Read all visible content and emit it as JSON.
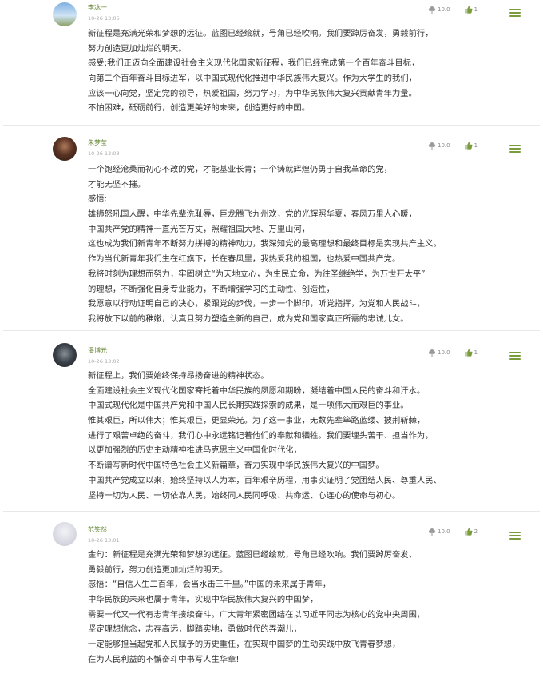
{
  "comments": [
    {
      "author": "李冰一",
      "time": "10-26 13:06",
      "score": "10.0",
      "likes": "1",
      "lines": [
        "新征程是充满光荣和梦想的远征。蓝图已经绘就，号角已经吹响。我们要踔厉奋发，勇毅前行，",
        "努力创造更加灿烂的明天。",
        "感受:我们正迈向全面建设社会主义现代化国家新征程，我们已经完成第一个百年奋斗目标，",
        "向第二个百年奋斗目标进军，以中国式现代化推进中华民族伟大复兴。作为大学生的我们，",
        "应该一心向党，坚定党的领导，热爱祖国，努力学习，为中华民族伟大复兴贡献青年力量。",
        "不怕困难，砥砺前行，创造更美好的未来，创造更好的中国。"
      ]
    },
    {
      "author": "朱梦莹",
      "time": "10-26 13:03",
      "score": "10.0",
      "likes": "1",
      "lines": [
        "一个饱经沧桑而初心不改的党，才能基业长青；一个铸就辉煌仍勇于自我革命的党，",
        "才能无坚不摧。",
        "感悟:",
        "雄狮怒吼国人醒，中华先辈洗耻辱，巨龙腾飞九州欢，党的光辉照华夏，春风万里人心暖，",
        "中国共产党的精神一直光芒万丈，照耀祖国大地、万里山河，",
        "这也成为我们新青年不断努力拼搏的精神动力，我深知党的最高理想和最终目标是实现共产主义。",
        "作为当代新青年我们生在红旗下，长在春风里，我热爱我的祖国，也热爱中国共产党。",
        "我将时刻为理想而努力，牢固树立“为天地立心，为生民立命，为往圣继绝学，为万世开太平”",
        "的理想，不断强化自身专业能力，不断增强学习的主动性、创造性，",
        "我愿意以行动证明自己的决心，紧跟党的步伐，一步一个脚印，听党指挥，为党和人民战斗，",
        "我将放下以前的稚嫩，认真且努力塑造全新的自己，成为党和国家真正所需的忠诚儿女。"
      ]
    },
    {
      "author": "潘博元",
      "time": "10-26 13:02",
      "score": "10.0",
      "likes": "1",
      "lines": [
        "新征程上，我们要始终保持昂扬奋进的精神状态。",
        "全面建设社会主义现代化国家寄托着中华民族的夙愿和期盼，凝结着中国人民的奋斗和汗水。",
        "中国式现代化是中国共产党和中国人民长期实践探索的成果，是一项伟大而艰巨的事业。",
        "惟其艰巨，所以伟大；惟其艰巨，更显荣光。为了这一事业，无数先辈筚路蓝缕、披荆斩棘，",
        "进行了艰苦卓绝的奋斗，我们心中永远铭记着他们的奉献和牺牲。我们要埋头苦干、担当作为，",
        "以更加强烈的历史主动精神推进马克思主义中国化时代化，",
        "不断谱写新时代中国特色社会主义新篇章，奋力实现中华民族伟大复兴的中国梦。",
        "中国共产党成立以来，始终坚持以人为本，百年艰辛历程，用事实证明了党团结人民、尊重人民、",
        "坚持一切为人民、一切依靠人民，始终同人民同呼吸、共命运、心连心的使命与初心。"
      ]
    },
    {
      "author": "范笑然",
      "time": "10-26 13:01",
      "score": "10.0",
      "likes": "2",
      "lines": [
        "金句：新征程是充满光荣和梦想的远征。蓝图已经绘就，号角已经吹响。我们要踔厉奋发、",
        "勇毅前行，努力创造更加灿烂的明天。",
        "感悟：“自信人生二百年，会当水击三千里。”中国的未来属于青年，",
        "中华民族的未来也属于青年。实现中华民族伟大复兴的中国梦，",
        "需要一代又一代有志青年接续奋斗。广大青年紧密团结在以习近平同志为核心的党中央周围，",
        "坚定理想信念，志存高远，脚踏实地，勇做时代的弄潮儿，",
        "一定能够担当起党和人民赋予的历史重任，在实现中国梦的生动实践中放飞青春梦想，",
        "在为人民利益的不懈奋斗中书写人生华章!"
      ]
    }
  ],
  "icons": {
    "score": "flower-icon",
    "like": "thumbs-up-icon",
    "menu": "menu-lines-icon"
  },
  "colors": {
    "author": "#6a8a3a",
    "accent": "#7a9c3c",
    "text": "#333333",
    "separator": "#e8e8e8"
  }
}
